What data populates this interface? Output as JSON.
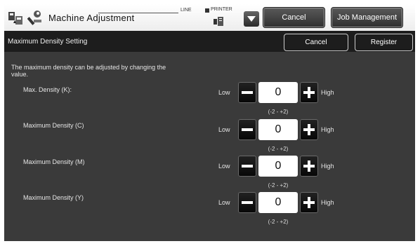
{
  "header": {
    "title": "Machine Adjustment",
    "line_label": "LINE",
    "printer_label": "PRINTER",
    "cancel_label": "Cancel",
    "job_management_label": "Job Management"
  },
  "subheader": {
    "title": "Maximum Density Setting",
    "cancel_label": "Cancel",
    "register_label": "Register"
  },
  "content": {
    "description": "The maximum density can be adjusted by changing the value.",
    "low_label": "Low",
    "high_label": "High",
    "rows": [
      {
        "label": "Max. Density (K):",
        "value": "0",
        "range": "(-2 - +2)"
      },
      {
        "label": "Maximum Density (C)",
        "value": "0",
        "range": "(-2 - +2)"
      },
      {
        "label": "Maximum Density (M)",
        "value": "0",
        "range": "(-2 - +2)"
      },
      {
        "label": "Maximum Density (Y)",
        "value": "0",
        "range": "(-2 - +2)"
      }
    ]
  },
  "icons": {
    "app": "machine-adjustment-icon",
    "wrench": "wrench-icon",
    "printer": "printer-icon",
    "dropdown": "triangle-down-icon",
    "minus": "minus-icon",
    "plus": "plus-icon"
  },
  "colors": {
    "background": "#3a3a3a",
    "subheader": "#1d1d1d",
    "topbar": "#ffffff",
    "button_dark": "#2f2f2f"
  }
}
